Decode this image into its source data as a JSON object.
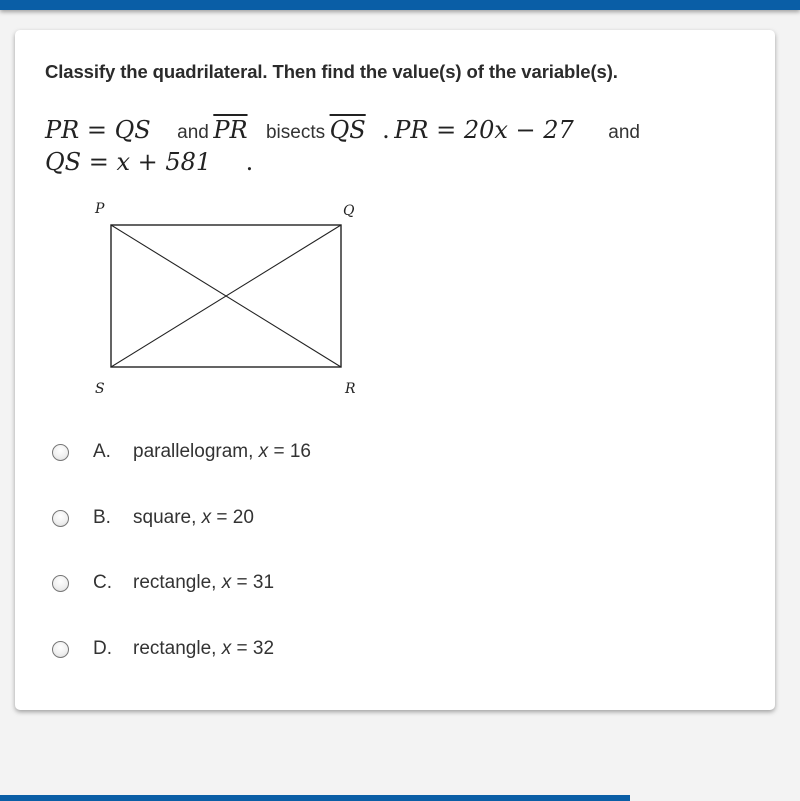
{
  "theme": {
    "accent": "#0a5ea6",
    "background": "#f3f3f3",
    "card": "#ffffff"
  },
  "question": {
    "instruction": "Classify the quadrilateral. Then find the value(s) of the variable(s).",
    "line1": {
      "eq1": "PR = QS",
      "and1": "and",
      "seg1": "PR",
      "bisects": "bisects",
      "seg2": "QS",
      "period": ".",
      "eq2": "PR = 20x − 27",
      "and2": "and"
    },
    "line2": {
      "eq3": "QS = x + 581",
      "period": "."
    }
  },
  "diagram": {
    "shape": "rectangle",
    "vertices": {
      "top_left": "P",
      "top_right": "Q",
      "bottom_right": "R",
      "bottom_left": "S"
    },
    "diagonals": [
      "PR",
      "QS"
    ]
  },
  "options": [
    {
      "letter": "A.",
      "text": "parallelogram, ",
      "var": "x",
      "value": " = 16",
      "selected": false
    },
    {
      "letter": "B.",
      "text": "square, ",
      "var": "x",
      "value": " = 20",
      "selected": false
    },
    {
      "letter": "C.",
      "text": "rectangle, ",
      "var": "x",
      "value": " = 31",
      "selected": false
    },
    {
      "letter": "D.",
      "text": "rectangle, ",
      "var": "x",
      "value": " = 32",
      "selected": false
    }
  ]
}
